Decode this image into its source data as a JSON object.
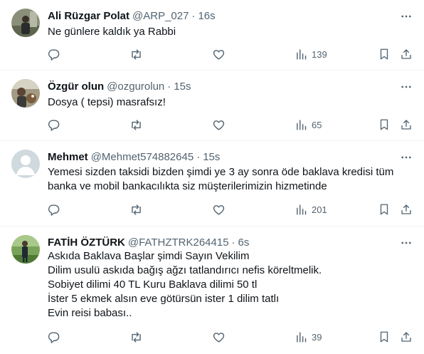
{
  "tweets": [
    {
      "name": "Ali Rüzgar Polat",
      "handle": "@ARP_027",
      "separator": "·",
      "time": "16s",
      "lines": [
        "Ne günlere kaldık ya Rabbi"
      ],
      "views": "139",
      "avatar_icon": "user-photo"
    },
    {
      "name": "Özgür olun",
      "handle": "@ozgurolun",
      "separator": "·",
      "time": "15s",
      "lines": [
        "Dosya ( tepsi) masrafsız!"
      ],
      "views": "65",
      "avatar_icon": "user-photo"
    },
    {
      "name": "Mehmet",
      "handle": "@Mehmet574882645",
      "separator": "·",
      "time": "15s",
      "lines": [
        "Yemesi sizden taksidi bizden şimdi ye 3 ay sonra öde baklava kredisi tüm",
        "banka ve mobil bankacılıkta siz müşterilerimizin hizmetinde"
      ],
      "views": "201",
      "avatar_icon": "default-avatar"
    },
    {
      "name": "FATİH ÖZTÜRK",
      "handle": "@FATHZTRK264415",
      "separator": "·",
      "time": "6s",
      "lines": [
        "Askıda Baklava Başlar şimdi Sayın Vekilim",
        "Dilim usulü askıda bağış ağzı tatlandırıcı nefis köreltmelik.",
        "Sobiyet dilimi 40 TL Kuru Baklava dilimi 50 tl",
        "İster 5 ekmek alsın eve götürsün ister 1 dilim tatlı",
        "Evin reisi babası.."
      ],
      "views": "39",
      "avatar_icon": "user-photo"
    }
  ],
  "colors": {
    "text": "#0f1419",
    "muted": "#536471",
    "border": "#eff3f4"
  },
  "icons": [
    "reply-icon",
    "retweet-icon",
    "like-icon",
    "views-icon",
    "bookmark-icon",
    "share-icon",
    "more-icon"
  ]
}
